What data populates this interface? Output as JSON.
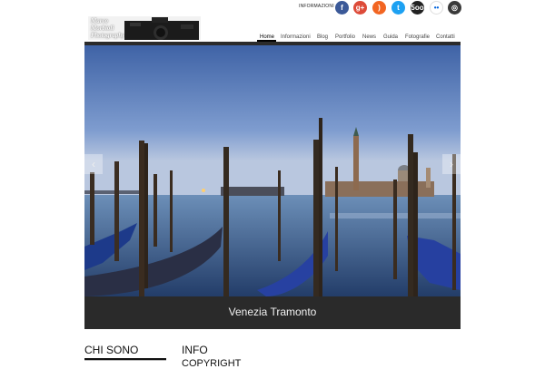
{
  "logo": {
    "text": "Marco\nMorbioli\nPhotography"
  },
  "header": {
    "info_label": "INFORMAZIONI"
  },
  "social": [
    {
      "icon": "facebook-icon",
      "glyph": "f",
      "color": "#3b5998"
    },
    {
      "icon": "google-plus-icon",
      "glyph": "g+",
      "color": "#dd4b39"
    },
    {
      "icon": "rss-icon",
      "glyph": ")",
      "color": "#f26522"
    },
    {
      "icon": "twitter-icon",
      "glyph": "t",
      "color": "#1da1f2"
    },
    {
      "icon": "500px-icon",
      "glyph": "5oo",
      "color": "#222222"
    },
    {
      "icon": "flickr-icon",
      "glyph": "••",
      "color": "#ffffff"
    },
    {
      "icon": "instagram-icon",
      "glyph": "◎",
      "color": "#3a3a3a"
    }
  ],
  "nav": [
    {
      "label": "Home",
      "active": true
    },
    {
      "label": "Informazioni"
    },
    {
      "label": "Blog"
    },
    {
      "label": "Portfolio"
    },
    {
      "label": "News"
    },
    {
      "label": "Guida"
    },
    {
      "label": "Fotografie"
    },
    {
      "label": "Contatti"
    }
  ],
  "slider": {
    "caption": "Venezia Tramonto",
    "prev_glyph": "‹",
    "next_glyph": "›"
  },
  "sections": {
    "left_title": "CHI SONO",
    "right_title": "INFO",
    "right_subtitle": "COPYRIGHT"
  }
}
